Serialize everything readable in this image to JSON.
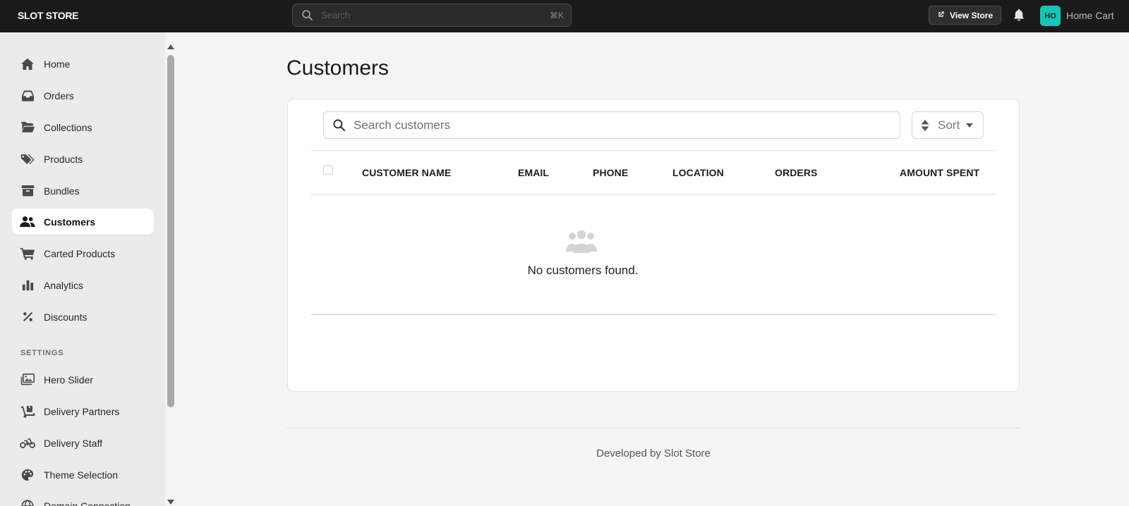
{
  "topbar": {
    "brand": "SLOT STORE",
    "search_placeholder": "Search",
    "search_shortcut": "⌘K",
    "view_store_label": "View Store",
    "avatar_initials": "HO",
    "store_name": "Home Cart"
  },
  "sidebar": {
    "items": [
      {
        "label": "Home",
        "icon": "home-icon"
      },
      {
        "label": "Orders",
        "icon": "inbox-icon"
      },
      {
        "label": "Collections",
        "icon": "folder-open-icon"
      },
      {
        "label": "Products",
        "icon": "tags-icon"
      },
      {
        "label": "Bundles",
        "icon": "archive-box-icon"
      },
      {
        "label": "Customers",
        "icon": "users-icon",
        "active": true
      },
      {
        "label": "Carted Products",
        "icon": "cart-icon"
      },
      {
        "label": "Analytics",
        "icon": "bar-chart-icon"
      },
      {
        "label": "Discounts",
        "icon": "percent-icon"
      }
    ],
    "settings_label": "SETTINGS",
    "settings_items": [
      {
        "label": "Hero Slider",
        "icon": "images-icon"
      },
      {
        "label": "Delivery Partners",
        "icon": "dolly-icon"
      },
      {
        "label": "Delivery Staff",
        "icon": "motorcycle-icon"
      },
      {
        "label": "Theme Selection",
        "icon": "palette-icon"
      },
      {
        "label": "Domain Connection",
        "icon": "globe-icon"
      }
    ]
  },
  "main": {
    "title": "Customers",
    "search_placeholder": "Search customers",
    "sort_label": "Sort",
    "columns": [
      "CUSTOMER NAME",
      "EMAIL",
      "PHONE",
      "LOCATION",
      "ORDERS",
      "AMOUNT SPENT"
    ],
    "empty_message": "No customers found."
  },
  "footer": {
    "text": "Developed by Slot Store"
  },
  "colors": {
    "topbar_bg": "#1a1a1a",
    "avatar_bg": "#19c3b6",
    "sidebar_bg": "#ebebeb",
    "page_bg": "#f5f5f5"
  }
}
